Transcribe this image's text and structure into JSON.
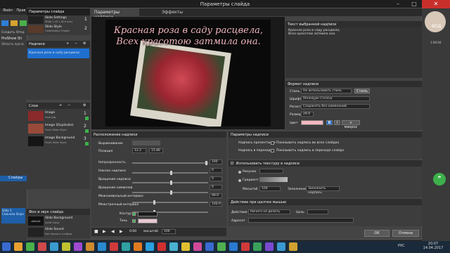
{
  "window": {
    "title": "Параметры слайда"
  },
  "menu": {
    "items": [
      "Файл",
      "Прав"
    ]
  },
  "bgapp": {
    "label1": "ProShow Sli",
    "label2": "Область просм",
    "buttons": [
      "Создать",
      "Откр",
      "Сохр"
    ],
    "slides_label": "Слайды",
    "slide1": "Slide 1",
    "slide1_sub": "Сменила Slope"
  },
  "tabs": {
    "slide_params": "Параметры слайда",
    "caption_params": "Параметры надписи",
    "effects": "Эффекты"
  },
  "slides_panel": {
    "items": [
      {
        "num": "1",
        "title": "Slide Settings",
        "sub": "Slide 1 of 1 (8.0 sec)"
      },
      {
        "num": "2",
        "title": "Slide Style",
        "sub": "Celebration Single"
      }
    ]
  },
  "captions_panel": {
    "title": "Надписи",
    "item": "Красная роза в саду расцвела"
  },
  "layers_panel": {
    "title": "Слои",
    "items": [
      {
        "num": "1",
        "title": "Image",
        "sub": "rose.jpg"
      },
      {
        "num": "2",
        "title": "Image (Duplicate)",
        "sub": "From Slide Style"
      },
      {
        "num": "3",
        "title": "Image Background",
        "sub": "From Slide Style"
      }
    ]
  },
  "bg_sound": {
    "title": "Фон и звук слайда",
    "items": [
      {
        "thumb": "default",
        "title": "Slide Background",
        "sub": "Solid Color"
      },
      {
        "thumb": "",
        "title": "Slide Sound",
        "sub": "Без звука в слайде"
      }
    ]
  },
  "preview": {
    "line1": "Красная роза в саду расцвела,",
    "line2": "Всех красотою затмила она."
  },
  "caption_text": {
    "title": "Текст выбранной надписи",
    "value": "Красная роза в саду расцвела,\nВсех красотою затмила она."
  },
  "format": {
    "title": "Формат надписи",
    "style_label": "Стиль",
    "style_value": "Не использовать стиль",
    "style_btn": "Стиль",
    "font_label": "Шрифт",
    "font_value": "Monotype Corsiva",
    "case_label": "Регистр",
    "case_value": "Сохранять без изменений",
    "size_label": "Размер",
    "size_value": "29.9",
    "color_label": "Цвет",
    "bold": "B",
    "italic": "I",
    "more": "+ макрос"
  },
  "position": {
    "title": "Расположение надписи",
    "align_label": "Выравнивание",
    "pos_label": "Позиция",
    "pos_x": "12.2",
    "pos_y": "15.86",
    "opacity_label": "Непрозрачность",
    "opacity_value": "100",
    "tilt_label": "Наклон надписи",
    "tilt_value": "0",
    "rotate_label": "Вращение надписи",
    "rotate_value": "0",
    "char_rotate_label": "Вращение символов",
    "char_rotate_value": "0",
    "spacing_label": "Межсимвольный интервал",
    "spacing_value": "99.9",
    "line_spacing_label": "Межстрочный интервал",
    "line_spacing_value": "100.9",
    "outline_label": "Контур",
    "shadow_label": "Тень"
  },
  "caption_options": {
    "title": "Параметры надписи",
    "show_label": "Надпись презентации",
    "show_text": "Показывать надпись во всех слайдах",
    "transition_label": "Надпись в переходе",
    "transition_text": "Показывать надпись в переходе слайда"
  },
  "texture": {
    "title": "Использовать текстуру в надписи",
    "picture_label": "Рисунок",
    "gradient_label": "Градиент",
    "scale_label": "Масштаб",
    "scale_value": "100",
    "fill_label": "Заполнение",
    "fill_value": "Заполнить надпись"
  },
  "click_action": {
    "title": "Действие при щелчке мышью",
    "action_label": "Действие",
    "action_value": "Ничего не делать",
    "target_label": "Цель",
    "address_label": "Адресат"
  },
  "playbar": {
    "time": "0:00",
    "zoom_label": "масштаб",
    "zoom_value": "100"
  },
  "footer": {
    "ok": "OK",
    "cancel": "Отмена"
  },
  "rightpanel": {
    "label": "ВОД",
    "time": "1:00:04"
  },
  "taskbar": {
    "lang": "РУС",
    "time": "20:07",
    "date": "14.04.2017"
  },
  "colors": {
    "accent": "#1e6fd0",
    "caption_text": "#f2b8c0",
    "background": "#444444"
  }
}
